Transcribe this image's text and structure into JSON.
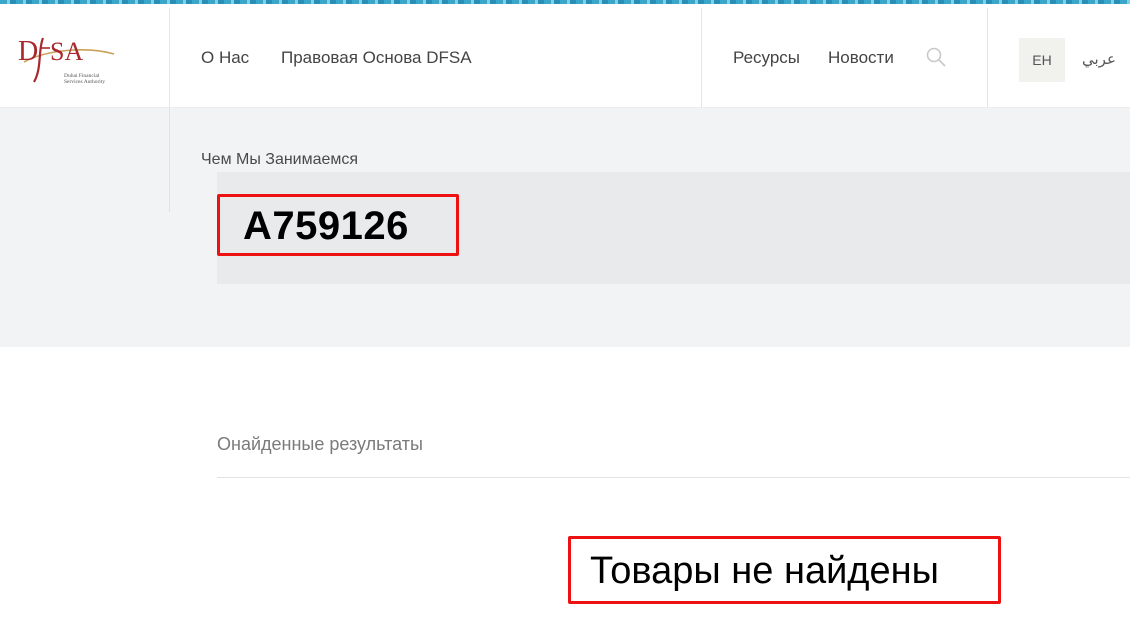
{
  "header": {
    "logo": {
      "mark": "DFSA",
      "subtitle_line1": "Dubai Financial",
      "subtitle_line2": "Services Authority",
      "colors": {
        "brand_red": "#a8282d",
        "brand_gold": "#c8a25a"
      }
    },
    "nav_left": [
      {
        "label": "О Нас"
      },
      {
        "label": "Правовая Основа DFSA"
      }
    ],
    "nav_right": [
      {
        "label": "Ресурсы"
      },
      {
        "label": "Новости"
      }
    ],
    "search_icon": "search-icon",
    "languages": {
      "current": "ЕН",
      "alternate": "عربي"
    }
  },
  "hero": {
    "breadcrumb": "Чем Мы Занимаемся",
    "search_query": "A759126"
  },
  "results": {
    "title": "Онайденные результаты",
    "empty_message": "Товары не найдены"
  },
  "colors": {
    "highlight_border": "#ee1111",
    "hero_bg": "#f2f3f5",
    "search_bg": "#e9eaec"
  }
}
